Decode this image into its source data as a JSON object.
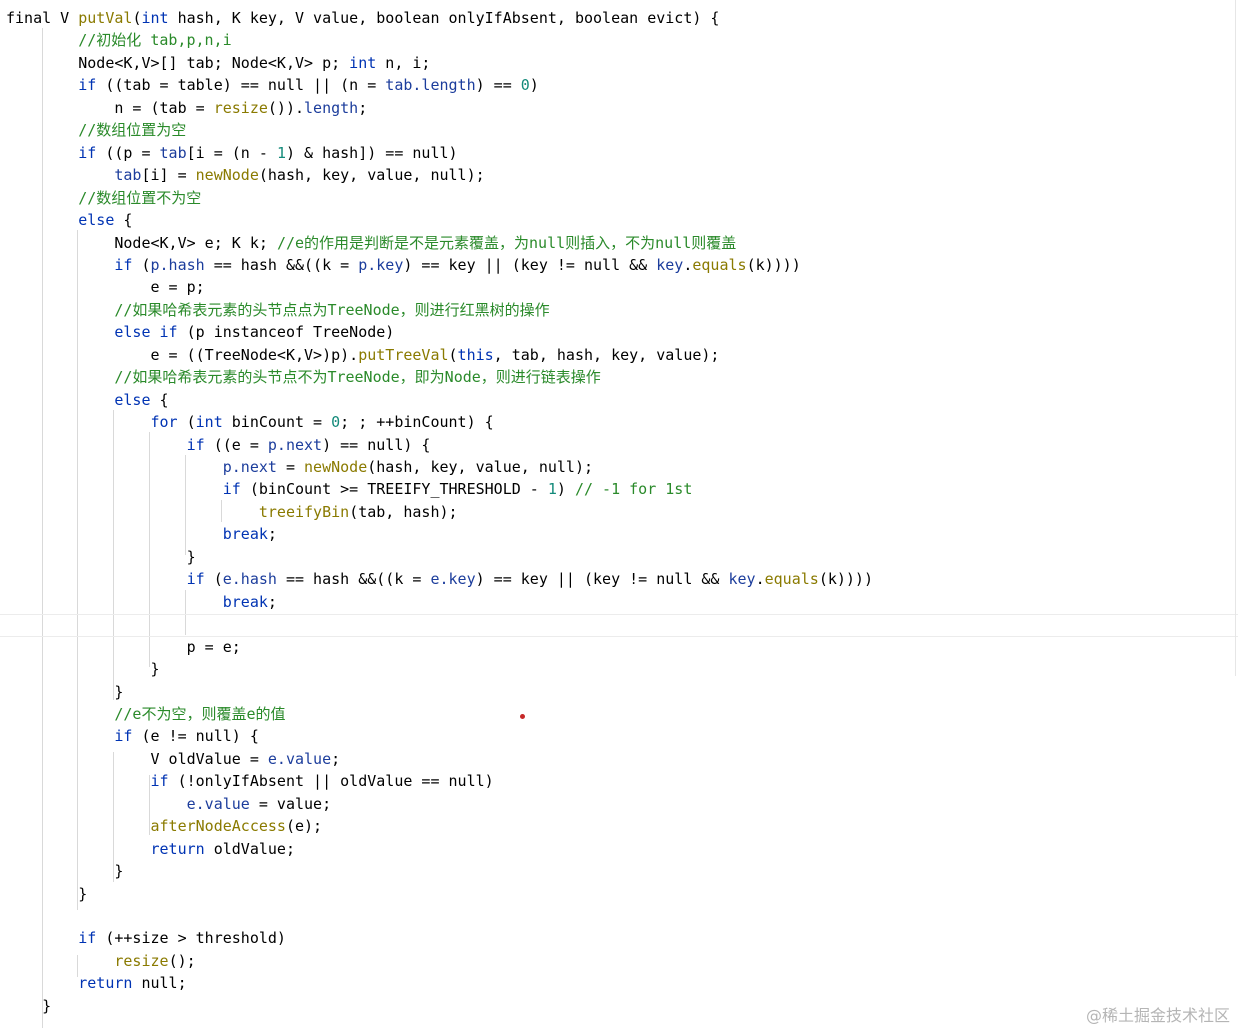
{
  "colors": {
    "plain": "#000000",
    "keyword": "#0033b3",
    "method": "#8a7a00",
    "field": "#1c3d9c",
    "comment": "#2a8a2a",
    "number": "#138a7a"
  },
  "watermark": "@稀土掘金技术社区",
  "code": {
    "lines": [
      [
        {
          "t": "final V ",
          "c": "plain"
        },
        {
          "t": "putVal",
          "c": "method"
        },
        {
          "t": "(",
          "c": "plain"
        },
        {
          "t": "int",
          "c": "keyword"
        },
        {
          "t": " hash, K key, V value, boolean onlyIfAbsent, boolean evict) {",
          "c": "plain"
        }
      ],
      [
        {
          "t": "        ",
          "c": "plain"
        },
        {
          "t": "//初始化 tab,p,n,i",
          "c": "comment"
        }
      ],
      [
        {
          "t": "        Node<K,V>[] tab; Node<K,V> p; ",
          "c": "plain"
        },
        {
          "t": "int",
          "c": "keyword"
        },
        {
          "t": " n, i;",
          "c": "plain"
        }
      ],
      [
        {
          "t": "        ",
          "c": "plain"
        },
        {
          "t": "if",
          "c": "keyword"
        },
        {
          "t": " ((tab = table) == null || (n = ",
          "c": "plain"
        },
        {
          "t": "tab.length",
          "c": "field"
        },
        {
          "t": ") == ",
          "c": "plain"
        },
        {
          "t": "0",
          "c": "number"
        },
        {
          "t": ")",
          "c": "plain"
        }
      ],
      [
        {
          "t": "            n = (tab = ",
          "c": "plain"
        },
        {
          "t": "resize",
          "c": "method"
        },
        {
          "t": "()).",
          "c": "plain"
        },
        {
          "t": "length",
          "c": "field"
        },
        {
          "t": ";",
          "c": "plain"
        }
      ],
      [
        {
          "t": "        ",
          "c": "plain"
        },
        {
          "t": "//数组位置为空",
          "c": "comment"
        }
      ],
      [
        {
          "t": "        ",
          "c": "plain"
        },
        {
          "t": "if",
          "c": "keyword"
        },
        {
          "t": " ((p = ",
          "c": "plain"
        },
        {
          "t": "tab",
          "c": "field"
        },
        {
          "t": "[i = (n - ",
          "c": "plain"
        },
        {
          "t": "1",
          "c": "number"
        },
        {
          "t": ") & hash]) == null)",
          "c": "plain"
        }
      ],
      [
        {
          "t": "            ",
          "c": "plain"
        },
        {
          "t": "tab",
          "c": "field"
        },
        {
          "t": "[i] = ",
          "c": "plain"
        },
        {
          "t": "newNode",
          "c": "method"
        },
        {
          "t": "(hash, key, value, null);",
          "c": "plain"
        }
      ],
      [
        {
          "t": "        ",
          "c": "plain"
        },
        {
          "t": "//数组位置不为空",
          "c": "comment"
        }
      ],
      [
        {
          "t": "        ",
          "c": "plain"
        },
        {
          "t": "else",
          "c": "keyword"
        },
        {
          "t": " {",
          "c": "plain"
        }
      ],
      [
        {
          "t": "            Node<K,V> e; K k; ",
          "c": "plain"
        },
        {
          "t": "//e的作用是判断是不是元素覆盖，为null则插入，不为null则覆盖",
          "c": "comment"
        }
      ],
      [
        {
          "t": "            ",
          "c": "plain"
        },
        {
          "t": "if",
          "c": "keyword"
        },
        {
          "t": " (",
          "c": "plain"
        },
        {
          "t": "p.hash",
          "c": "field"
        },
        {
          "t": " == hash &&((k = ",
          "c": "plain"
        },
        {
          "t": "p.key",
          "c": "field"
        },
        {
          "t": ") == key || (key != null && ",
          "c": "plain"
        },
        {
          "t": "key",
          "c": "field"
        },
        {
          "t": ".",
          "c": "plain"
        },
        {
          "t": "equals",
          "c": "method"
        },
        {
          "t": "(k))))",
          "c": "plain"
        }
      ],
      [
        {
          "t": "                e = p;",
          "c": "plain"
        }
      ],
      [
        {
          "t": "            ",
          "c": "plain"
        },
        {
          "t": "//如果哈希表元素的头节点点为TreeNode，则进行红黑树的操作",
          "c": "comment"
        }
      ],
      [
        {
          "t": "            ",
          "c": "plain"
        },
        {
          "t": "else if",
          "c": "keyword"
        },
        {
          "t": " (p instanceof TreeNode)",
          "c": "plain"
        }
      ],
      [
        {
          "t": "                e = ((TreeNode<K,V>)p).",
          "c": "plain"
        },
        {
          "t": "putTreeVal",
          "c": "method"
        },
        {
          "t": "(",
          "c": "plain"
        },
        {
          "t": "this",
          "c": "keyword"
        },
        {
          "t": ", tab, hash, key, value);",
          "c": "plain"
        }
      ],
      [
        {
          "t": "            ",
          "c": "plain"
        },
        {
          "t": "//如果哈希表元素的头节点不为TreeNode，即为Node，则进行链表操作",
          "c": "comment"
        }
      ],
      [
        {
          "t": "            ",
          "c": "plain"
        },
        {
          "t": "else",
          "c": "keyword"
        },
        {
          "t": " {",
          "c": "plain"
        }
      ],
      [
        {
          "t": "                ",
          "c": "plain"
        },
        {
          "t": "for",
          "c": "keyword"
        },
        {
          "t": " (",
          "c": "plain"
        },
        {
          "t": "int",
          "c": "keyword"
        },
        {
          "t": " binCount = ",
          "c": "plain"
        },
        {
          "t": "0",
          "c": "number"
        },
        {
          "t": "; ; ++binCount) {",
          "c": "plain"
        }
      ],
      [
        {
          "t": "                    ",
          "c": "plain"
        },
        {
          "t": "if",
          "c": "keyword"
        },
        {
          "t": " ((e = ",
          "c": "plain"
        },
        {
          "t": "p.next",
          "c": "field"
        },
        {
          "t": ") == null) {",
          "c": "plain"
        }
      ],
      [
        {
          "t": "                        ",
          "c": "plain"
        },
        {
          "t": "p.next",
          "c": "field"
        },
        {
          "t": " = ",
          "c": "plain"
        },
        {
          "t": "newNode",
          "c": "method"
        },
        {
          "t": "(hash, key, value, null);",
          "c": "plain"
        }
      ],
      [
        {
          "t": "                        ",
          "c": "plain"
        },
        {
          "t": "if",
          "c": "keyword"
        },
        {
          "t": " (binCount >= TREEIFY_THRESHOLD - ",
          "c": "plain"
        },
        {
          "t": "1",
          "c": "number"
        },
        {
          "t": ") ",
          "c": "plain"
        },
        {
          "t": "// -1 for 1st",
          "c": "comment"
        }
      ],
      [
        {
          "t": "                            ",
          "c": "plain"
        },
        {
          "t": "treeifyBin",
          "c": "method"
        },
        {
          "t": "(tab, hash);",
          "c": "plain"
        }
      ],
      [
        {
          "t": "                        ",
          "c": "plain"
        },
        {
          "t": "break",
          "c": "keyword"
        },
        {
          "t": ";",
          "c": "plain"
        }
      ],
      [
        {
          "t": "                    }",
          "c": "plain"
        }
      ],
      [
        {
          "t": "                    ",
          "c": "plain"
        },
        {
          "t": "if",
          "c": "keyword"
        },
        {
          "t": " (",
          "c": "plain"
        },
        {
          "t": "e.hash",
          "c": "field"
        },
        {
          "t": " == hash &&((k = ",
          "c": "plain"
        },
        {
          "t": "e.key",
          "c": "field"
        },
        {
          "t": ") == key || (key != null && ",
          "c": "plain"
        },
        {
          "t": "key",
          "c": "field"
        },
        {
          "t": ".",
          "c": "plain"
        },
        {
          "t": "equals",
          "c": "method"
        },
        {
          "t": "(k))))",
          "c": "plain"
        }
      ],
      [
        {
          "t": "                        ",
          "c": "plain"
        },
        {
          "t": "break",
          "c": "keyword"
        },
        {
          "t": ";",
          "c": "plain"
        }
      ],
      [],
      [
        {
          "t": "                    p = e;",
          "c": "plain"
        }
      ],
      [
        {
          "t": "                }",
          "c": "plain"
        }
      ],
      [
        {
          "t": "            }",
          "c": "plain"
        }
      ],
      [
        {
          "t": "            ",
          "c": "plain"
        },
        {
          "t": "//e不为空，则覆盖e的值",
          "c": "comment"
        }
      ],
      [
        {
          "t": "            ",
          "c": "plain"
        },
        {
          "t": "if",
          "c": "keyword"
        },
        {
          "t": " (e != null) {",
          "c": "plain"
        }
      ],
      [
        {
          "t": "                V oldValue = ",
          "c": "plain"
        },
        {
          "t": "e.value",
          "c": "field"
        },
        {
          "t": ";",
          "c": "plain"
        }
      ],
      [
        {
          "t": "                ",
          "c": "plain"
        },
        {
          "t": "if",
          "c": "keyword"
        },
        {
          "t": " (!onlyIfAbsent || oldValue == null)",
          "c": "plain"
        }
      ],
      [
        {
          "t": "                    ",
          "c": "plain"
        },
        {
          "t": "e.value",
          "c": "field"
        },
        {
          "t": " = value;",
          "c": "plain"
        }
      ],
      [
        {
          "t": "                ",
          "c": "plain"
        },
        {
          "t": "afterNodeAccess",
          "c": "method"
        },
        {
          "t": "(e);",
          "c": "plain"
        }
      ],
      [
        {
          "t": "                ",
          "c": "plain"
        },
        {
          "t": "return",
          "c": "keyword"
        },
        {
          "t": " oldValue;",
          "c": "plain"
        }
      ],
      [
        {
          "t": "            }",
          "c": "plain"
        }
      ],
      [
        {
          "t": "        }",
          "c": "plain"
        }
      ],
      [],
      [
        {
          "t": "        ",
          "c": "plain"
        },
        {
          "t": "if",
          "c": "keyword"
        },
        {
          "t": " (++size > threshold)",
          "c": "plain"
        }
      ],
      [
        {
          "t": "            ",
          "c": "plain"
        },
        {
          "t": "resize",
          "c": "method"
        },
        {
          "t": "();",
          "c": "plain"
        }
      ],
      [
        {
          "t": "        ",
          "c": "plain"
        },
        {
          "t": "return",
          "c": "keyword"
        },
        {
          "t": " null;",
          "c": "plain"
        }
      ],
      [
        {
          "t": "    }",
          "c": "plain"
        }
      ]
    ]
  }
}
